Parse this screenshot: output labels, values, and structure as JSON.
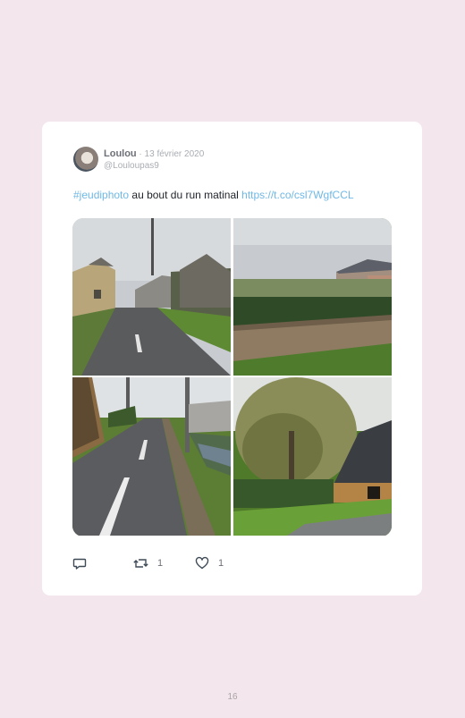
{
  "tweet": {
    "author_name": "Loulou",
    "separator": " · ",
    "date": "13 février 2020",
    "handle": "@Louloupas9",
    "hashtag": "#jeudiphoto",
    "text": " au bout du run matinal ",
    "link": "https://t.co/csl7WgfCCL",
    "photos": [
      {
        "subject": "village-road"
      },
      {
        "subject": "field-and-houses"
      },
      {
        "subject": "road-with-stream"
      },
      {
        "subject": "willow-and-barn"
      }
    ],
    "actions": {
      "reply_count": "",
      "retweet_count": "1",
      "like_count": "1"
    }
  },
  "page": {
    "number": "16"
  },
  "colors": {
    "background": "#f3e6ec",
    "card": "#ffffff",
    "link": "#6fb8e6",
    "muted": "#a9adb3"
  },
  "icons": [
    "reply-icon",
    "retweet-icon",
    "heart-icon"
  ]
}
